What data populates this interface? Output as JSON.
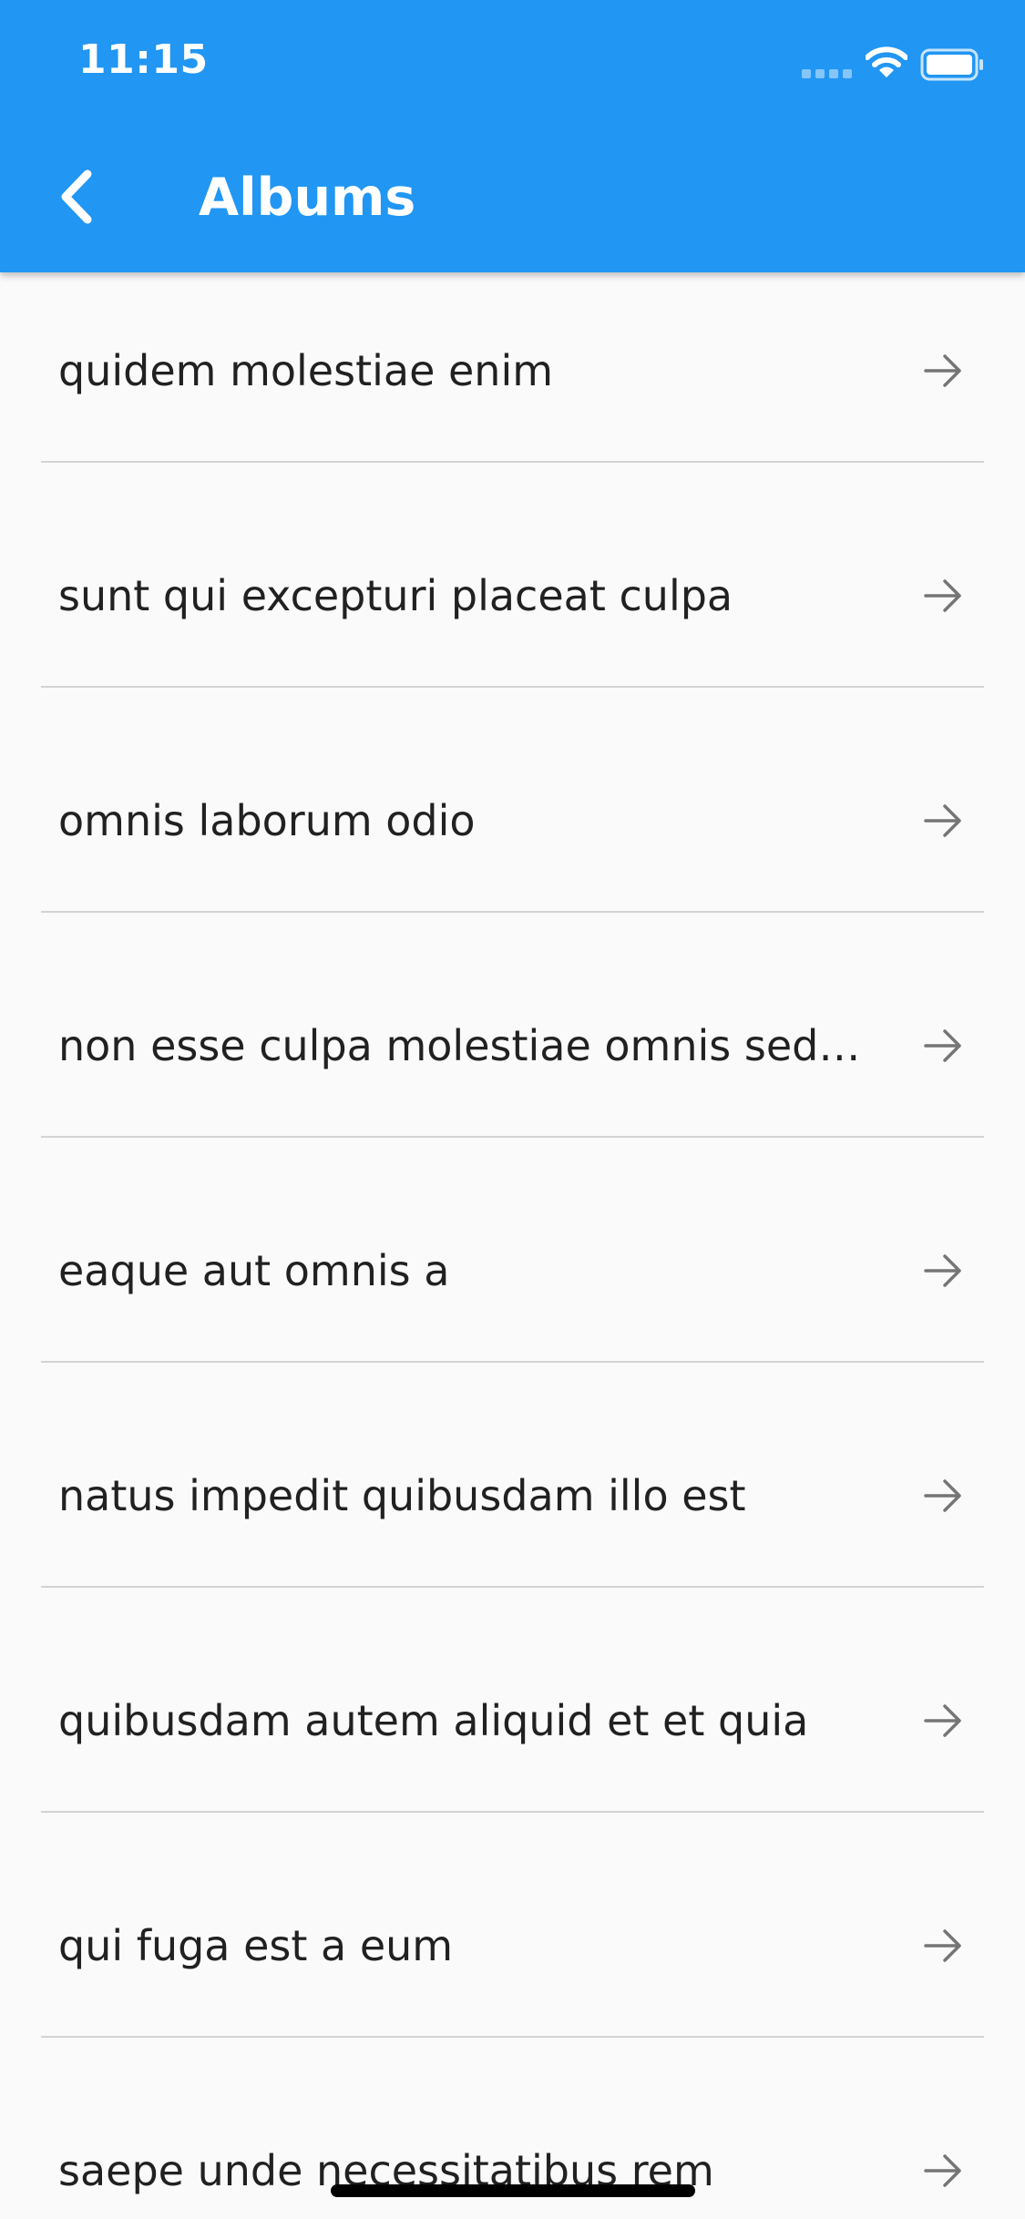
{
  "status_bar": {
    "time": "11:15"
  },
  "app_bar": {
    "title": "Albums",
    "back_icon": "chevron-left-icon",
    "background_color": "#2196f3"
  },
  "albums": {
    "item_icon": "arrow-right-icon",
    "items": [
      {
        "label": "quidem molestiae enim"
      },
      {
        "label": "sunt qui excepturi placeat culpa"
      },
      {
        "label": "omnis laborum odio"
      },
      {
        "label": "non esse culpa molestiae omnis sed ..."
      },
      {
        "label": "eaque aut omnis a"
      },
      {
        "label": "natus impedit quibusdam illo est"
      },
      {
        "label": "quibusdam autem aliquid et et quia"
      },
      {
        "label": "qui fuga est a eum"
      },
      {
        "label": "saepe unde necessitatibus rem"
      }
    ]
  }
}
